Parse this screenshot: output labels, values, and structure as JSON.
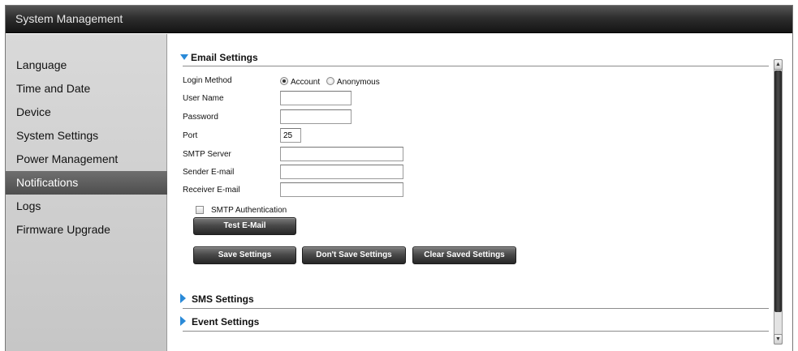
{
  "window": {
    "title": "System Management"
  },
  "sidebar": {
    "items": [
      {
        "label": "Language",
        "active": false
      },
      {
        "label": "Time and Date",
        "active": false
      },
      {
        "label": "Device",
        "active": false
      },
      {
        "label": "System Settings",
        "active": false
      },
      {
        "label": "Power Management",
        "active": false
      },
      {
        "label": "Notifications",
        "active": true
      },
      {
        "label": "Logs",
        "active": false
      },
      {
        "label": "Firmware Upgrade",
        "active": false
      }
    ]
  },
  "email_settings": {
    "title": "Email Settings",
    "expanded": true,
    "login_method": {
      "label": "Login Method",
      "options": [
        "Account",
        "Anonymous"
      ],
      "selected": "Account"
    },
    "user_name": {
      "label": "User Name",
      "value": ""
    },
    "password": {
      "label": "Password",
      "value": ""
    },
    "port": {
      "label": "Port",
      "value": "25"
    },
    "smtp_server": {
      "label": "SMTP Server",
      "value": ""
    },
    "sender_email": {
      "label": "Sender E-mail",
      "value": ""
    },
    "receiver_email": {
      "label": "Receiver E-mail",
      "value": ""
    },
    "smtp_auth": {
      "label": "SMTP Authentication",
      "checked": false
    },
    "test_button": "Test E-Mail",
    "save_button": "Save Settings",
    "dont_save_button": "Don't Save Settings",
    "clear_button": "Clear Saved Settings"
  },
  "sms_settings": {
    "title": "SMS Settings",
    "expanded": false
  },
  "event_settings": {
    "title": "Event Settings",
    "expanded": false
  },
  "colors": {
    "accent_triangle": "#2a8ad8",
    "sidebar_active": "#5a5a5a",
    "titlebar": "#1f1f1f"
  },
  "icons": {
    "expand": "triangle-down-icon",
    "collapse": "triangle-right-icon",
    "scroll_up": "chevron-up-icon",
    "scroll_down": "chevron-down-icon"
  }
}
